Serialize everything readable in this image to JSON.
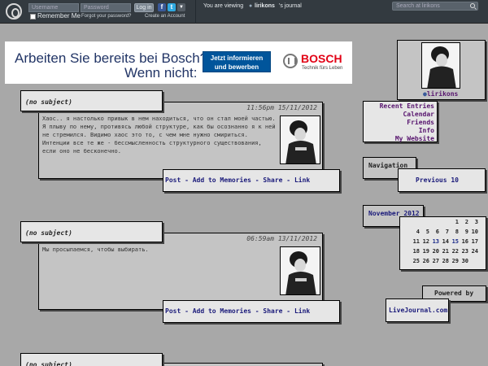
{
  "topbar": {
    "username_placeholder": "Username",
    "password_placeholder": "Password",
    "login_label": "Log in",
    "remember_label": "Remember Me",
    "forgot_label": "Forgot your password?",
    "create_label": "Create an Account",
    "viewing_prefix": "You are viewing",
    "journal_user": "lirikons",
    "viewing_suffix": "'s journal",
    "search_placeholder": "Search at lirikons"
  },
  "ad": {
    "line1": "Arbeiten Sie bereits bei Bosch?",
    "line2": "Wenn nicht:",
    "cta_line1": "Jetzt informieren",
    "cta_line2": "und bewerben",
    "brand": "BOSCH",
    "tagline": "Technik fürs Leben"
  },
  "entries": [
    {
      "subject": "(no subject)",
      "date": "11:56pm 15/11/2012",
      "text": "Хаос.. я настолько привык в нем находиться, что он стал моей частью. Я плыву по нему, противясь любой структуре, как бы осознанно я к ней не стремился. Видимо хаос это то, с чем мне нужно смириться. Интенции все те же - бессмысленность структурного существования, если оно не бесконечно.",
      "links": "Post - Add to Memories - Share - Link"
    },
    {
      "subject": "(no subject)",
      "date": "06:59am 13/11/2012",
      "text": "Мы просыпаемся, чтобы выбирать.",
      "links": "Post - Add to Memories - Share - Link"
    },
    {
      "subject": "(no subject)"
    }
  ],
  "sidebar": {
    "profile_name": "lirikons",
    "nav_links": [
      "Recent Entries",
      "Calendar",
      "Friends",
      "Info",
      "My Website"
    ],
    "navigation_title": "Navigation",
    "previous_label": "Previous 10",
    "calendar_title": "November 2012",
    "calendar_rows": [
      [
        "",
        "",
        "",
        "",
        "1",
        "2",
        "3"
      ],
      [
        "4",
        "5",
        "6",
        "7",
        "8",
        "9",
        "10"
      ],
      [
        "11",
        "12",
        "13",
        "14",
        "15",
        "16",
        "17"
      ],
      [
        "18",
        "19",
        "20",
        "21",
        "22",
        "23",
        "24"
      ],
      [
        "25",
        "26",
        "27",
        "28",
        "29",
        "30",
        ""
      ]
    ],
    "calendar_links": [
      "13",
      "15"
    ],
    "powered_title": "Powered by",
    "powered_link": "LiveJournal.com"
  },
  "colors": {
    "topbar": "#333a40",
    "background": "#a8a8a8",
    "link": "#57146e",
    "brand_red": "#e20015",
    "ad_blue": "#00559b"
  }
}
